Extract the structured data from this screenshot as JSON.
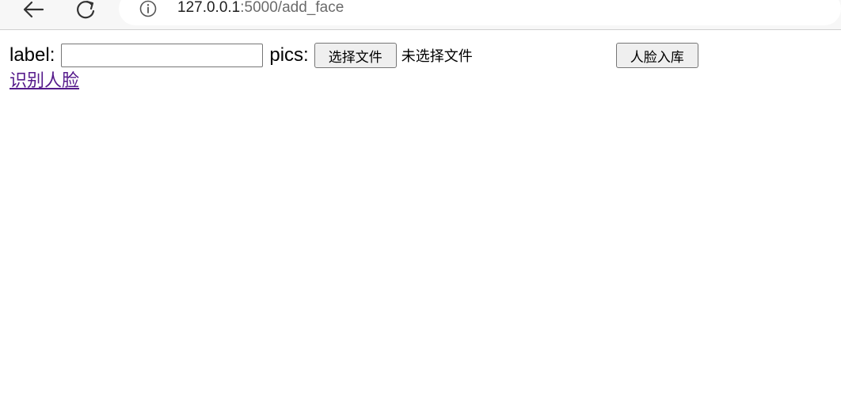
{
  "browser": {
    "url_host": "127.0.0.1",
    "url_path": ":5000/add_face"
  },
  "form": {
    "label_text": "label:",
    "label_value": "",
    "pics_text": "pics:",
    "file_button_label": "选择文件",
    "file_status": "未选择文件",
    "submit_label": "人脸入库"
  },
  "links": {
    "recognize_face": "识别人脸"
  }
}
